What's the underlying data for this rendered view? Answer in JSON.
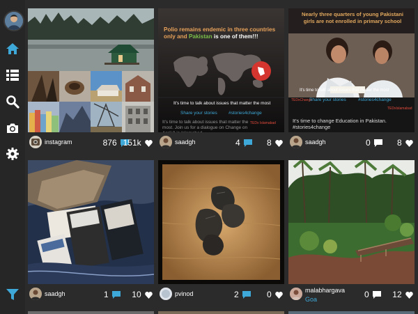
{
  "sidebar": {
    "items": [
      {
        "name": "home",
        "icon": "home-icon"
      },
      {
        "name": "list",
        "icon": "list-icon"
      },
      {
        "name": "search",
        "icon": "search-icon"
      },
      {
        "name": "camera",
        "icon": "camera-icon"
      },
      {
        "name": "settings",
        "icon": "gear-icon"
      },
      {
        "name": "filter",
        "icon": "filter-icon"
      }
    ],
    "accent": "#3ea8d8"
  },
  "posts": [
    {
      "username": "instagram",
      "comments": "876",
      "likes": "151k"
    },
    {
      "username": "saadgh",
      "comments": "4",
      "likes": "8",
      "poster": {
        "headline_a": "Polio remains endemic in three countries",
        "headline_b": "only and ",
        "headline_c": "Pakistan",
        "headline_d": " is one of them!!!",
        "tagline": "It's time to talk about issues that matter the most",
        "share": "Share your stories",
        "hashtag": "#stories4change",
        "brand": "TEDx Islamabad",
        "caption": "It's time to talk about issues that matter the most. Join us for a dialogue on Change on April 8 in Islamabad."
      }
    },
    {
      "username": "saadgh",
      "comments": "0",
      "likes": "8",
      "poster": {
        "headline": "Nearly three quarters of young Pakistani girls are not enrolled in primary school",
        "tagline": "It's time to talk about issues that matter the most",
        "brand_left": "TEDxChange",
        "share": "Share your stories",
        "hashtag": "#stories4change",
        "brand_right": "TEDxIslamabad",
        "caption": "It's time to change Education in Pakistan. #stories4change"
      }
    },
    {
      "username": "saadgh",
      "comments": "1",
      "likes": "10"
    },
    {
      "username": "pvinod",
      "comments": "2",
      "likes": "0"
    },
    {
      "username": "malabhargava",
      "location": "Goa",
      "comments": "0",
      "likes": "12"
    }
  ]
}
